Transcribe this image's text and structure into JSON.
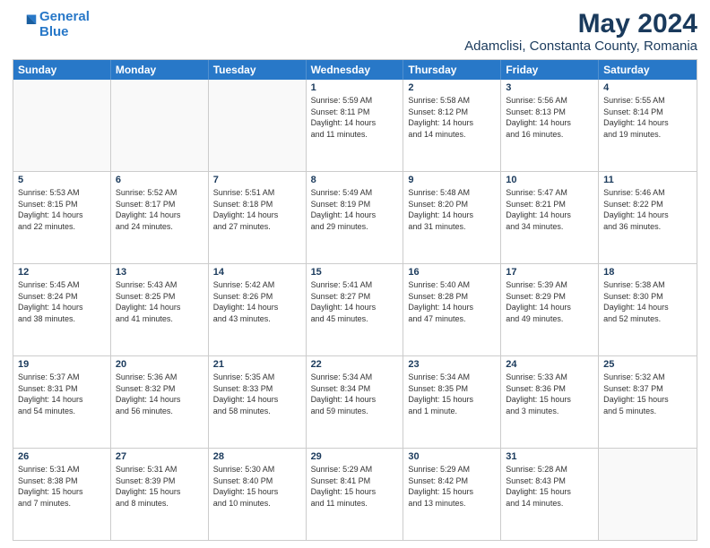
{
  "logo": {
    "line1": "General",
    "line2": "Blue"
  },
  "title": "May 2024",
  "subtitle": "Adamclisi, Constanta County, Romania",
  "header_days": [
    "Sunday",
    "Monday",
    "Tuesday",
    "Wednesday",
    "Thursday",
    "Friday",
    "Saturday"
  ],
  "rows": [
    [
      {
        "day": "",
        "info": "",
        "empty": true
      },
      {
        "day": "",
        "info": "",
        "empty": true
      },
      {
        "day": "",
        "info": "",
        "empty": true
      },
      {
        "day": "1",
        "info": "Sunrise: 5:59 AM\nSunset: 8:11 PM\nDaylight: 14 hours\nand 11 minutes."
      },
      {
        "day": "2",
        "info": "Sunrise: 5:58 AM\nSunset: 8:12 PM\nDaylight: 14 hours\nand 14 minutes."
      },
      {
        "day": "3",
        "info": "Sunrise: 5:56 AM\nSunset: 8:13 PM\nDaylight: 14 hours\nand 16 minutes."
      },
      {
        "day": "4",
        "info": "Sunrise: 5:55 AM\nSunset: 8:14 PM\nDaylight: 14 hours\nand 19 minutes."
      }
    ],
    [
      {
        "day": "5",
        "info": "Sunrise: 5:53 AM\nSunset: 8:15 PM\nDaylight: 14 hours\nand 22 minutes."
      },
      {
        "day": "6",
        "info": "Sunrise: 5:52 AM\nSunset: 8:17 PM\nDaylight: 14 hours\nand 24 minutes."
      },
      {
        "day": "7",
        "info": "Sunrise: 5:51 AM\nSunset: 8:18 PM\nDaylight: 14 hours\nand 27 minutes."
      },
      {
        "day": "8",
        "info": "Sunrise: 5:49 AM\nSunset: 8:19 PM\nDaylight: 14 hours\nand 29 minutes."
      },
      {
        "day": "9",
        "info": "Sunrise: 5:48 AM\nSunset: 8:20 PM\nDaylight: 14 hours\nand 31 minutes."
      },
      {
        "day": "10",
        "info": "Sunrise: 5:47 AM\nSunset: 8:21 PM\nDaylight: 14 hours\nand 34 minutes."
      },
      {
        "day": "11",
        "info": "Sunrise: 5:46 AM\nSunset: 8:22 PM\nDaylight: 14 hours\nand 36 minutes."
      }
    ],
    [
      {
        "day": "12",
        "info": "Sunrise: 5:45 AM\nSunset: 8:24 PM\nDaylight: 14 hours\nand 38 minutes."
      },
      {
        "day": "13",
        "info": "Sunrise: 5:43 AM\nSunset: 8:25 PM\nDaylight: 14 hours\nand 41 minutes."
      },
      {
        "day": "14",
        "info": "Sunrise: 5:42 AM\nSunset: 8:26 PM\nDaylight: 14 hours\nand 43 minutes."
      },
      {
        "day": "15",
        "info": "Sunrise: 5:41 AM\nSunset: 8:27 PM\nDaylight: 14 hours\nand 45 minutes."
      },
      {
        "day": "16",
        "info": "Sunrise: 5:40 AM\nSunset: 8:28 PM\nDaylight: 14 hours\nand 47 minutes."
      },
      {
        "day": "17",
        "info": "Sunrise: 5:39 AM\nSunset: 8:29 PM\nDaylight: 14 hours\nand 49 minutes."
      },
      {
        "day": "18",
        "info": "Sunrise: 5:38 AM\nSunset: 8:30 PM\nDaylight: 14 hours\nand 52 minutes."
      }
    ],
    [
      {
        "day": "19",
        "info": "Sunrise: 5:37 AM\nSunset: 8:31 PM\nDaylight: 14 hours\nand 54 minutes."
      },
      {
        "day": "20",
        "info": "Sunrise: 5:36 AM\nSunset: 8:32 PM\nDaylight: 14 hours\nand 56 minutes."
      },
      {
        "day": "21",
        "info": "Sunrise: 5:35 AM\nSunset: 8:33 PM\nDaylight: 14 hours\nand 58 minutes."
      },
      {
        "day": "22",
        "info": "Sunrise: 5:34 AM\nSunset: 8:34 PM\nDaylight: 14 hours\nand 59 minutes."
      },
      {
        "day": "23",
        "info": "Sunrise: 5:34 AM\nSunset: 8:35 PM\nDaylight: 15 hours\nand 1 minute."
      },
      {
        "day": "24",
        "info": "Sunrise: 5:33 AM\nSunset: 8:36 PM\nDaylight: 15 hours\nand 3 minutes."
      },
      {
        "day": "25",
        "info": "Sunrise: 5:32 AM\nSunset: 8:37 PM\nDaylight: 15 hours\nand 5 minutes."
      }
    ],
    [
      {
        "day": "26",
        "info": "Sunrise: 5:31 AM\nSunset: 8:38 PM\nDaylight: 15 hours\nand 7 minutes."
      },
      {
        "day": "27",
        "info": "Sunrise: 5:31 AM\nSunset: 8:39 PM\nDaylight: 15 hours\nand 8 minutes."
      },
      {
        "day": "28",
        "info": "Sunrise: 5:30 AM\nSunset: 8:40 PM\nDaylight: 15 hours\nand 10 minutes."
      },
      {
        "day": "29",
        "info": "Sunrise: 5:29 AM\nSunset: 8:41 PM\nDaylight: 15 hours\nand 11 minutes."
      },
      {
        "day": "30",
        "info": "Sunrise: 5:29 AM\nSunset: 8:42 PM\nDaylight: 15 hours\nand 13 minutes."
      },
      {
        "day": "31",
        "info": "Sunrise: 5:28 AM\nSunset: 8:43 PM\nDaylight: 15 hours\nand 14 minutes."
      },
      {
        "day": "",
        "info": "",
        "empty": true
      }
    ]
  ]
}
